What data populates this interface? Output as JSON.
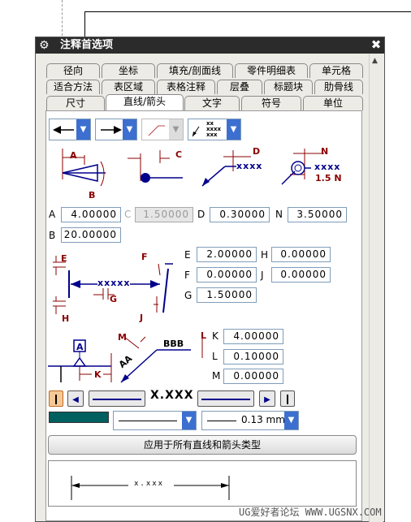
{
  "dialog": {
    "title": "注释首选项",
    "close_label": "✖",
    "gear_glyph": "⚙"
  },
  "tabs": {
    "row1": [
      "径向",
      "坐标",
      "填充/剖面线",
      "零件明细表",
      "单元格"
    ],
    "row2": [
      "适合方法",
      "表区域",
      "表格注释",
      "层叠",
      "标题块",
      "肋骨线"
    ],
    "row3": [
      "尺寸",
      "直线/箭头",
      "文字",
      "符号",
      "单位"
    ],
    "active": "直线/箭头"
  },
  "line_arrow": {
    "style_combo": {
      "leader_text": "xx\nxxxx\nxxx"
    },
    "dim_letters": {
      "A": "A",
      "B": "B",
      "C": "C",
      "D": "D",
      "N": "N",
      "half_n": "1.5 N",
      "E": "E",
      "F": "F",
      "G": "G",
      "H": "H",
      "J": "J",
      "K": "K",
      "L": "L",
      "M": "M"
    },
    "sample_text": {
      "xs4": "xxxx",
      "xs5": "xxxxx",
      "aa": "AA",
      "bbb": "BBB",
      "boxA": "A"
    },
    "fields": {
      "A": {
        "label": "A",
        "value": "4.00000"
      },
      "C": {
        "label": "C",
        "value": "1.50000"
      },
      "D": {
        "label": "D",
        "value": "0.30000"
      },
      "N": {
        "label": "N",
        "value": "3.50000"
      },
      "B": {
        "label": "B",
        "value": "20.00000"
      },
      "E": {
        "label": "E",
        "value": "2.00000"
      },
      "H": {
        "label": "H",
        "value": "0.00000"
      },
      "F": {
        "label": "F",
        "value": "0.00000"
      },
      "J": {
        "label": "J",
        "value": "0.00000"
      },
      "G": {
        "label": "G",
        "value": "1.50000"
      },
      "K": {
        "label": "K",
        "value": "4.00000"
      },
      "L": {
        "label": "L",
        "value": "0.10000"
      },
      "M": {
        "label": "M",
        "value": "0.00000"
      }
    },
    "dim_format_text": "X.XXX",
    "color_swatch": "#006060",
    "line_width": "0.13 mm",
    "apply_button": "应用于所有直线和箭头类型",
    "preview_text": "x.xxx"
  },
  "watermark": "UG爱好者论坛 WWW.UGSNX.COM"
}
